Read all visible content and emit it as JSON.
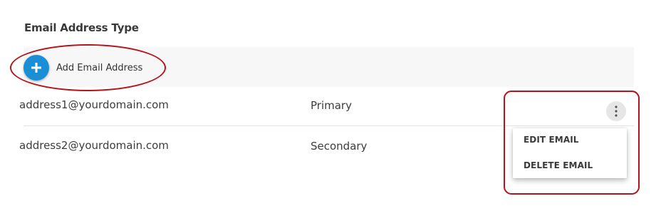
{
  "header": {
    "columns_label": "Email Address Type"
  },
  "add_row": {
    "button_icon": "plus-icon",
    "label": "Add Email Address"
  },
  "emails": [
    {
      "address": "address1@yourdomain.com",
      "type": "Primary"
    },
    {
      "address": "address2@yourdomain.com",
      "type": "Secondary"
    }
  ],
  "row_actions": {
    "icon": "more-vertical-icon",
    "menu": [
      "EDIT EMAIL",
      "DELETE EMAIL"
    ]
  },
  "colors": {
    "accent": "#1a8fd6",
    "annotation": "#b5141b"
  }
}
